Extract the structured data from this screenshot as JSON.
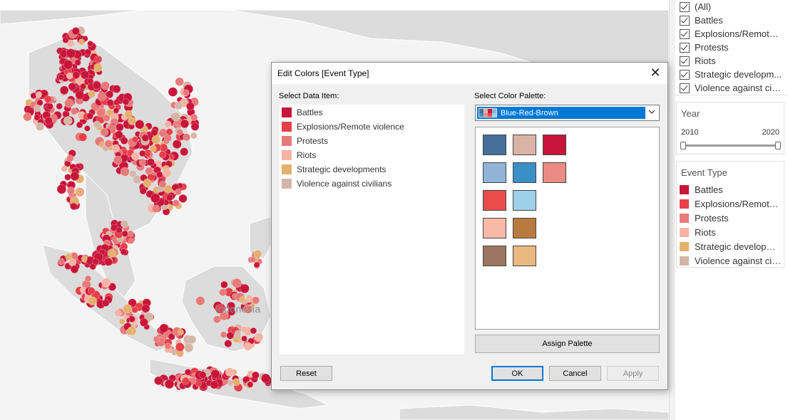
{
  "map": {
    "country_label": "Indonesia",
    "colors": {
      "battles": "#c8163a",
      "explosions": "#e8404a",
      "protests": "#e87a7a",
      "riots": "#f7b3a3",
      "strategic": "#e3b06e",
      "violence": "#d4b6a8",
      "land": "#dcdcdc",
      "water": "#f4f4f4"
    }
  },
  "filters": {
    "items": [
      {
        "label": "(All)",
        "checked": true
      },
      {
        "label": "Battles",
        "checked": true
      },
      {
        "label": "Explosions/Remote ...",
        "checked": true
      },
      {
        "label": "Protests",
        "checked": true
      },
      {
        "label": "Riots",
        "checked": true
      },
      {
        "label": "Strategic developm...",
        "checked": true
      },
      {
        "label": "Violence against civ...",
        "checked": true
      }
    ]
  },
  "year": {
    "title": "Year",
    "min": "2010",
    "max": "2020"
  },
  "legend": {
    "title": "Event Type",
    "items": [
      {
        "label": "Battles",
        "color": "#c8163a"
      },
      {
        "label": "Explosions/Remote v...",
        "color": "#e8404a"
      },
      {
        "label": "Protests",
        "color": "#e87a7a"
      },
      {
        "label": "Riots",
        "color": "#f7b3a3"
      },
      {
        "label": "Strategic developme...",
        "color": "#e3b06e"
      },
      {
        "label": "Violence against civil...",
        "color": "#d4b6a8"
      }
    ]
  },
  "dialog": {
    "title": "Edit Colors [Event Type]",
    "close_icon": "close-icon",
    "data_item_label": "Select Data Item:",
    "data_items": [
      {
        "label": "Battles",
        "color": "#c8163a"
      },
      {
        "label": "Explosions/Remote violence",
        "color": "#e8404a"
      },
      {
        "label": "Protests",
        "color": "#e87a7a"
      },
      {
        "label": "Riots",
        "color": "#f7b3a3"
      },
      {
        "label": "Strategic developments",
        "color": "#e3b06e"
      },
      {
        "label": "Violence against civilians",
        "color": "#d4b6a8"
      }
    ],
    "palette_label": "Select Color Palette:",
    "palette_selected": "Blue-Red-Brown",
    "palette_swatches": [
      "#466f9d",
      "#d9b4a6",
      "#c8163a",
      "#91b3d7",
      "#3a8fc6",
      "#ec8b83",
      "#ea4c4c",
      "#9fd0ea",
      "#f8b9a6",
      "#b97a40",
      "#9c7660",
      "#e9b97f"
    ],
    "buttons": {
      "assign": "Assign Palette",
      "reset": "Reset",
      "ok": "OK",
      "cancel": "Cancel",
      "apply": "Apply"
    }
  }
}
